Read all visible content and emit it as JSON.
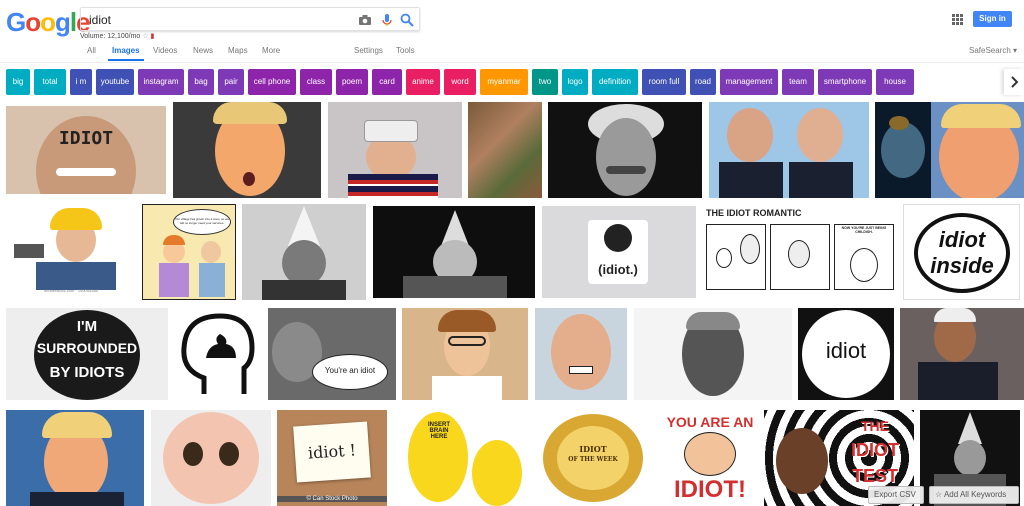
{
  "search": {
    "logo": [
      "G",
      "o",
      "o",
      "g",
      "l",
      "e"
    ],
    "logo_colors": [
      "#4285f4",
      "#ea4335",
      "#fbbc05",
      "#4285f4",
      "#34a853",
      "#ea4335"
    ],
    "query": "idiot",
    "volume": "Volume: 12,100/mo"
  },
  "header": {
    "signin_label": "Sign in"
  },
  "tabs": {
    "all": "All",
    "images": "Images",
    "videos": "Videos",
    "news": "News",
    "maps": "Maps",
    "more": "More",
    "settings": "Settings",
    "tools": "Tools",
    "safesearch": "SafeSearch ▾"
  },
  "chips": [
    {
      "label": "big",
      "color": "#00acc1"
    },
    {
      "label": "total",
      "color": "#00acc1"
    },
    {
      "label": "i m",
      "color": "#3f51b5"
    },
    {
      "label": "youtube",
      "color": "#3f51b5"
    },
    {
      "label": "instagram",
      "color": "#7e3ab6"
    },
    {
      "label": "bag",
      "color": "#7e3ab6"
    },
    {
      "label": "pair",
      "color": "#7e3ab6"
    },
    {
      "label": "cell phone",
      "color": "#8e24aa"
    },
    {
      "label": "class",
      "color": "#8e24aa"
    },
    {
      "label": "poem",
      "color": "#8e24aa"
    },
    {
      "label": "card",
      "color": "#8e24aa"
    },
    {
      "label": "anime",
      "color": "#e91e63"
    },
    {
      "label": "word",
      "color": "#e91e63"
    },
    {
      "label": "myanmar",
      "color": "#ff9800"
    },
    {
      "label": "two",
      "color": "#009688"
    },
    {
      "label": "logo",
      "color": "#00acc1"
    },
    {
      "label": "definition",
      "color": "#00acc1"
    },
    {
      "label": "room full",
      "color": "#3f51b5"
    },
    {
      "label": "road",
      "color": "#3f51b5"
    },
    {
      "label": "management",
      "color": "#7e3ab6"
    },
    {
      "label": "team",
      "color": "#7e3ab6"
    },
    {
      "label": "smartphone",
      "color": "#7e3ab6"
    },
    {
      "label": "house",
      "color": "#7e3ab6"
    }
  ],
  "images": {
    "r1_idiot_forehead": "IDIOT",
    "r2_romantic_title": "THE IDIOT ROMANTIC",
    "r2_romantic_bubble": "NOW YOU'RE JUST BEING CHILDISH.",
    "r2_idiot_circle": "(idiot.)",
    "r2_intel_line1": "idiot",
    "r2_intel_line2": "inside",
    "r2_shutter": "shutterstock.com · 159055386",
    "r2_comic_bubble": "Our village has grown into a town, so we will no longer need your services.",
    "r3_button_line1": "I'M",
    "r3_button_line2": "SURROUNDED",
    "r3_button_line3": "BY IDIOTS",
    "r3_bubble": "You're an idiot",
    "r3_logo": "idiot",
    "r4_note": "idiot !",
    "r4_canstock": "© Can Stock Photo",
    "r4_homer": "INSERT BRAIN HERE",
    "r4_award_line1": "IDIOT",
    "r4_award_line2": "OF THE WEEK",
    "r4_youare_line1": "YOU ARE AN",
    "r4_youare_line2": "IDIOT!",
    "r4_test_line1": "THE",
    "r4_test_line2": "IDIOT",
    "r4_test_line3": "TEST"
  },
  "overlay": {
    "export_csv": "Export CSV",
    "add_keywords": "Add All Keywords"
  }
}
